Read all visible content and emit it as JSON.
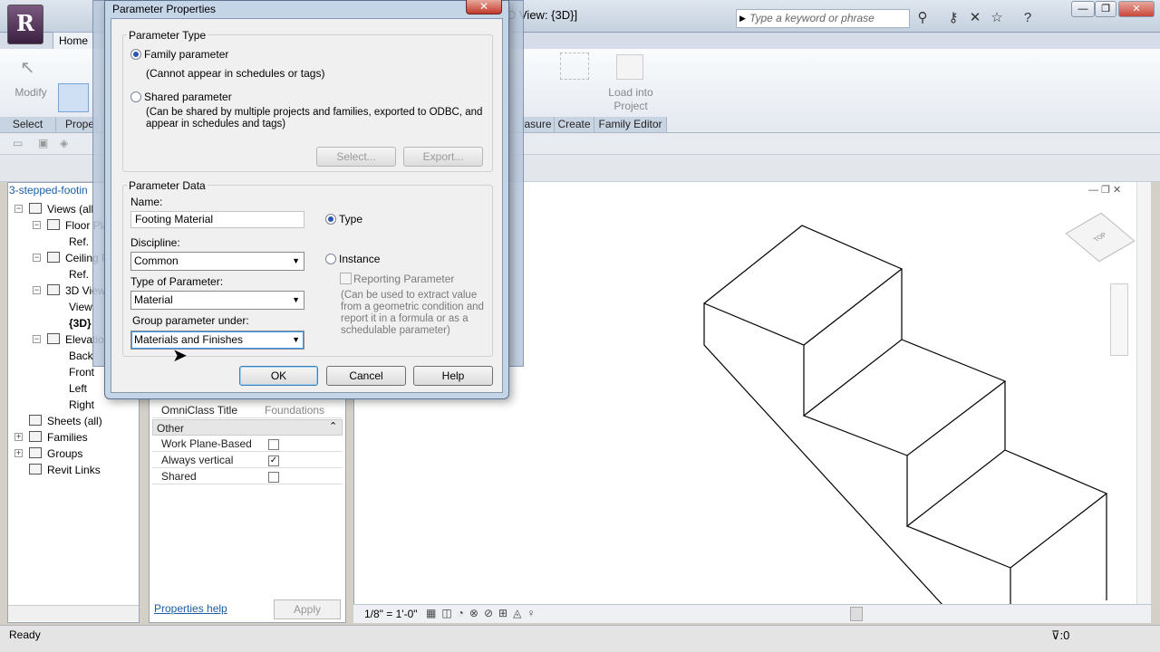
{
  "app": {
    "logo_letter": "R",
    "view_title": "D View: {3D}]",
    "search_placeholder": "Type a keyword or phrase",
    "home_tab": "Home"
  },
  "ribbon": {
    "modify_label": "Modify",
    "select_label": "Select",
    "props_label": "Prope",
    "measure_label": "asure",
    "create_label": "Create",
    "family_editor_label": "Family Editor",
    "load_into_project_line1": "Load into",
    "load_into_project_line2": "Project"
  },
  "browser": {
    "title": "3-stepped-footin",
    "items": [
      {
        "label": "Views (all",
        "level": 0,
        "expander": "−"
      },
      {
        "label": "Floor Pla",
        "level": 1,
        "expander": "−"
      },
      {
        "label": "Ref.",
        "level": 2,
        "expander": ""
      },
      {
        "label": "Ceiling P",
        "level": 1,
        "expander": "−"
      },
      {
        "label": "Ref.",
        "level": 2,
        "expander": ""
      },
      {
        "label": "3D View",
        "level": 1,
        "expander": "−"
      },
      {
        "label": "View",
        "level": 2,
        "expander": ""
      },
      {
        "label": "{3D}",
        "level": 2,
        "expander": ""
      },
      {
        "label": "Elevatio",
        "level": 1,
        "expander": "−"
      },
      {
        "label": "Back",
        "level": 2,
        "expander": ""
      },
      {
        "label": "Front",
        "level": 2,
        "expander": ""
      },
      {
        "label": "Left",
        "level": 2,
        "expander": ""
      },
      {
        "label": "Right",
        "level": 2,
        "expander": ""
      },
      {
        "label": "Sheets (all)",
        "level": 0,
        "expander": ""
      },
      {
        "label": "Families",
        "level": 0,
        "expander": "+"
      },
      {
        "label": "Groups",
        "level": 0,
        "expander": "+"
      },
      {
        "label": "Revit Links",
        "level": 0,
        "expander": ""
      }
    ]
  },
  "properties": {
    "omniclass_title_key": "OmniClass Title",
    "omniclass_title_value": "Foundations",
    "group_other": "Other",
    "work_plane_based": "Work Plane-Based",
    "always_vertical": "Always vertical",
    "always_vertical_checked": "✓",
    "shared": "Shared",
    "help_link": "Properties help",
    "apply": "Apply"
  },
  "view_control": {
    "scale": "1/8\" = 1'-0\""
  },
  "status": {
    "text": "Ready",
    "filter_count": ":0"
  },
  "dialog": {
    "title": "Parameter Properties",
    "parameter_type_label": "Parameter Type",
    "family_parameter": "Family parameter",
    "family_parameter_note": "(Cannot appear in schedules or tags)",
    "shared_parameter": "Shared parameter",
    "shared_parameter_note_1": "(Can be shared by multiple projects and families, exported to ODBC, and",
    "shared_parameter_note_2": "appear in schedules and tags)",
    "select_button": "Select...",
    "export_button": "Export...",
    "parameter_data_label": "Parameter Data",
    "name_label": "Name:",
    "name_value": "Footing Material",
    "discipline_label": "Discipline:",
    "discipline_value": "Common",
    "type_of_parameter_label": "Type of Parameter:",
    "type_of_parameter_value": "Material",
    "group_under_label": "Group parameter under:",
    "group_under_value": "Materials and Finishes",
    "type_radio": "Type",
    "instance_radio": "Instance",
    "reporting_parameter": "Reporting Parameter",
    "reporting_note_1": "(Can be used to extract value",
    "reporting_note_2": "from a geometric condition and",
    "reporting_note_3": "report it in a formula or as a",
    "reporting_note_4": "schedulable parameter)",
    "ok": "OK",
    "cancel": "Cancel",
    "help": "Help"
  }
}
